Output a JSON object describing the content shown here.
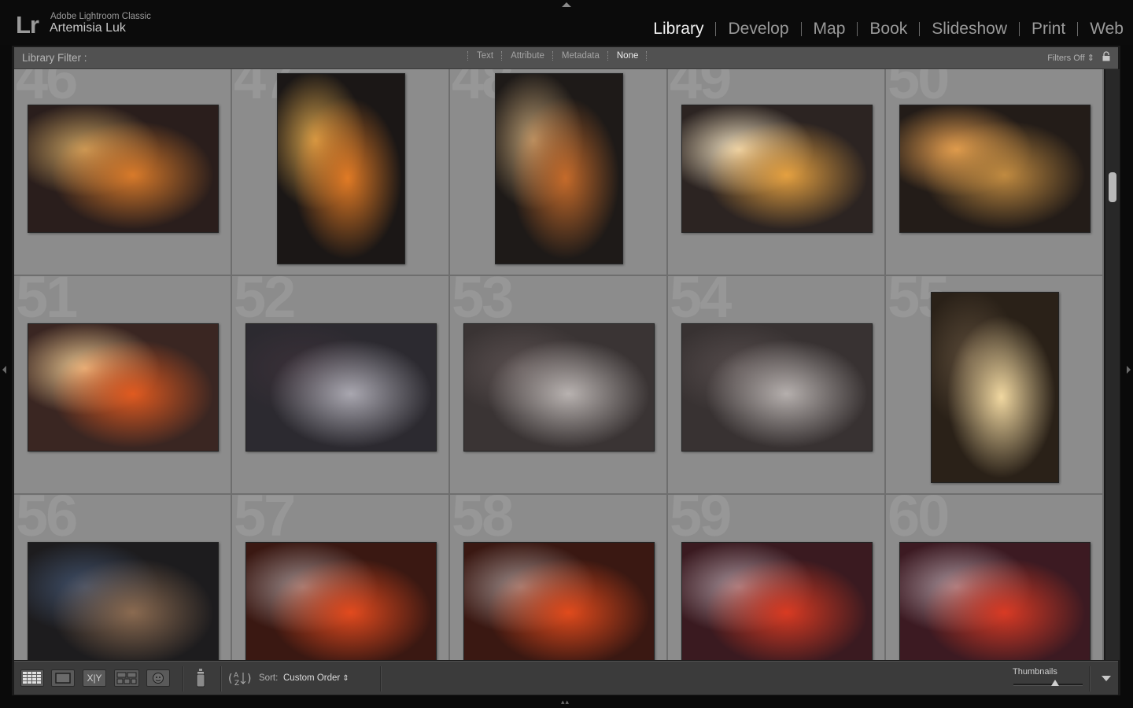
{
  "app": {
    "logo": "Lr",
    "name": "Adobe Lightroom Classic",
    "user": "Artemisia Luk"
  },
  "modules": [
    {
      "label": "Library",
      "active": true
    },
    {
      "label": "Develop",
      "active": false
    },
    {
      "label": "Map",
      "active": false
    },
    {
      "label": "Book",
      "active": false
    },
    {
      "label": "Slideshow",
      "active": false
    },
    {
      "label": "Print",
      "active": false
    },
    {
      "label": "Web",
      "active": false
    }
  ],
  "filter_bar": {
    "label": "Library Filter :",
    "tabs": [
      {
        "label": "Text",
        "active": false
      },
      {
        "label": "Attribute",
        "active": false
      },
      {
        "label": "Metadata",
        "active": false
      },
      {
        "label": "None",
        "active": true
      }
    ],
    "filters_state": "Filters Off",
    "lock_icon": "padlock-icon"
  },
  "grid": {
    "cells": [
      {
        "number": "46",
        "orientation": "landscape",
        "subject": "cupcakes and christmas lights",
        "colors": [
          "#2a1e1c",
          "#d87a2a",
          "#c8a060"
        ]
      },
      {
        "number": "47",
        "orientation": "portrait",
        "subject": "snack table",
        "colors": [
          "#1b1716",
          "#e07a25",
          "#d4a04a"
        ]
      },
      {
        "number": "48",
        "orientation": "portrait",
        "subject": "snack table",
        "colors": [
          "#1e1a18",
          "#c46a2a",
          "#b89a70"
        ]
      },
      {
        "number": "49",
        "orientation": "landscape",
        "subject": "cupcakes close-up",
        "colors": [
          "#2c2422",
          "#e4a040",
          "#f0e0c0"
        ]
      },
      {
        "number": "50",
        "orientation": "landscape",
        "subject": "cookie platter",
        "colors": [
          "#231c18",
          "#c08a40",
          "#e8a050"
        ]
      },
      {
        "number": "51",
        "orientation": "landscape",
        "subject": "cupcakes and fruit",
        "colors": [
          "#3a2622",
          "#e05a20",
          "#eac690"
        ]
      },
      {
        "number": "52",
        "orientation": "landscape",
        "subject": "dj booth",
        "colors": [
          "#2c2a30",
          "#a9a7b0",
          "#3a3038"
        ]
      },
      {
        "number": "53",
        "orientation": "landscape",
        "subject": "dj at table",
        "colors": [
          "#3a3434",
          "#b8b2b0",
          "#5a5050"
        ]
      },
      {
        "number": "54",
        "orientation": "landscape",
        "subject": "dj at table",
        "colors": [
          "#383232",
          "#b5afad",
          "#554c4c"
        ]
      },
      {
        "number": "55",
        "orientation": "portrait",
        "subject": "string lights on wall",
        "colors": [
          "#2a2118",
          "#f0d7a0",
          "#5a4a38"
        ]
      },
      {
        "number": "56",
        "orientation": "landscape",
        "subject": "two guests smiling",
        "colors": [
          "#1d1c1e",
          "#8a6a50",
          "#40506a"
        ]
      },
      {
        "number": "57",
        "orientation": "landscape",
        "subject": "red lit room with seated guest",
        "colors": [
          "#3a1812",
          "#e24a1e",
          "#9a8a8a"
        ]
      },
      {
        "number": "58",
        "orientation": "landscape",
        "subject": "red lit room with seated guest",
        "colors": [
          "#3a1812",
          "#e04a1c",
          "#9a8a88"
        ]
      },
      {
        "number": "59",
        "orientation": "landscape",
        "subject": "red lit room",
        "colors": [
          "#3a1a20",
          "#d83a22",
          "#a49098"
        ]
      },
      {
        "number": "60",
        "orientation": "landscape",
        "subject": "red lit room",
        "colors": [
          "#3c1a22",
          "#d83a24",
          "#a6929a"
        ]
      }
    ]
  },
  "toolbar": {
    "view_buttons": [
      {
        "name": "grid-view-button",
        "icon": "grid-icon"
      },
      {
        "name": "loupe-view-button",
        "icon": "loupe-icon"
      },
      {
        "name": "compare-view-button",
        "icon": "compare-icon",
        "label": "X|Y"
      },
      {
        "name": "survey-view-button",
        "icon": "survey-icon"
      },
      {
        "name": "people-view-button",
        "icon": "face-icon"
      }
    ],
    "painter_icon": "spray-can-icon",
    "sort_direction_icon": "sort-az-icon",
    "sort_label": "Sort:",
    "sort_value": "Custom Order",
    "thumbnails_label": "Thumbnails",
    "thumbnail_size": 0.6
  }
}
